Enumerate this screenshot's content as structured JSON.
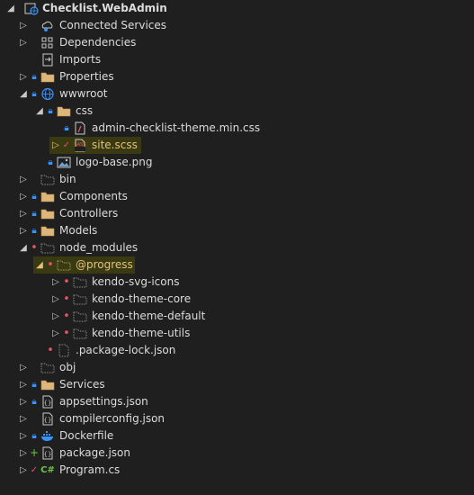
{
  "solution_explorer": {
    "project": "Checklist.WebAdmin",
    "items": {
      "connected_services": "Connected Services",
      "dependencies": "Dependencies",
      "imports": "Imports",
      "properties": "Properties",
      "wwwroot": "wwwroot",
      "css": "css",
      "theme_css": "admin-checklist-theme.min.css",
      "site_scss": "site.scss",
      "logo": "logo-base.png",
      "bin": "bin",
      "components": "Components",
      "controllers": "Controllers",
      "models": "Models",
      "node_modules": "node_modules",
      "progress": "@progress",
      "kendo_svg_icons": "kendo-svg-icons",
      "kendo_theme_core": "kendo-theme-core",
      "kendo_theme_default": "kendo-theme-default",
      "kendo_theme_utils": "kendo-theme-utils",
      "package_lock": ".package-lock.json",
      "obj": "obj",
      "services": "Services",
      "appsettings": "appsettings.json",
      "compilerconfig": "compilerconfig.json",
      "dockerfile": "Dockerfile",
      "package_json": "package.json",
      "program_cs": "Program.cs"
    },
    "file_icon_text": {
      "json_braces": "{}",
      "csharp": "C#",
      "scss_tag": "SASS"
    },
    "colors": {
      "background": "#1f1f1f",
      "text": "#dcdcdc",
      "highlight": "#3a3a12",
      "highlight_text": "#e5c07b",
      "lock_blue": "#3794ff",
      "excluded_red": "#e05561",
      "checked_red": "#e05561",
      "added_green": "#6cc644",
      "folder": "#dcb67a"
    },
    "icons": {
      "expanded": "triangle-down-icon",
      "collapsed": "triangle-right-icon",
      "lock": "lock-icon",
      "excluded": "red-dot-icon",
      "checkmark": "red-check-icon",
      "added": "plus-icon"
    }
  }
}
